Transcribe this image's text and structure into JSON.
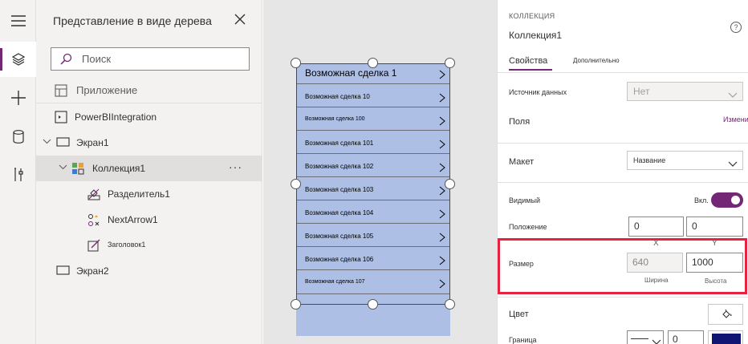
{
  "rail": {
    "icons": [
      "hamburger-icon",
      "layers-icon",
      "plus-icon",
      "database-icon",
      "tools-icon"
    ]
  },
  "tree": {
    "title": "Представление в виде дерева",
    "search_placeholder": "Поиск",
    "app_item": "Приложение",
    "items": [
      {
        "label": "PowerBIIntegration",
        "icon": "powerbi-icon"
      },
      {
        "label": "Экран1",
        "icon": "screen-icon"
      },
      {
        "label": "Коллекция1",
        "icon": "gallery-icon"
      },
      {
        "label": "Разделитель1",
        "icon": "separator-icon"
      },
      {
        "label": "NextArrow1",
        "icon": "icon-control-icon"
      },
      {
        "label": "Заголовок1",
        "icon": "label-icon"
      },
      {
        "label": "Экран2",
        "icon": "screen-icon"
      }
    ],
    "more": "···"
  },
  "gallery": {
    "title_row": "Возможная сделка 1",
    "rows": [
      "Возможная сделка 10",
      "Возможная сделка 100",
      "Возможная сделка 101",
      "Возможная сделка 102",
      "Возможная сделка 103",
      "Возможная сделка 104",
      "Возможная сделка 105",
      "Возможная сделка 106",
      "Возможная сделка 107"
    ]
  },
  "props": {
    "kind": "КОЛЛЕКЦИЯ",
    "name": "Коллекция1",
    "help": "?",
    "tabs": [
      "Свойства",
      "Дополнительно"
    ],
    "data_source_label": "Источник данных",
    "data_source_value": "Нет",
    "fields_label": "Поля",
    "fields_link": "Изменить",
    "layout_label": "Макет",
    "layout_value": "Название",
    "visible_label": "Видимый",
    "visible_value": "Вкл.",
    "position_label": "Положение",
    "position_x": "0",
    "position_y": "0",
    "x_label": "X",
    "y_label": "Y",
    "size_label": "Размер",
    "width_value": "640",
    "height_value": "1000",
    "width_label": "Ширина",
    "height_label": "Высота",
    "color_label": "Цвет",
    "border_label": "Граница",
    "border_width": "0",
    "border_color": "#101473",
    "accent": "#742774",
    "highlight": "#e8233d"
  }
}
